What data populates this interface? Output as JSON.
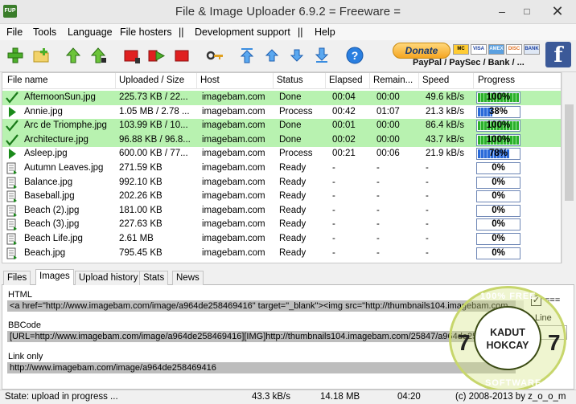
{
  "window": {
    "title": "File & Image Uploader 6.9.2  = Freeware =",
    "app_icon_text": "FUP",
    "minimize": "–",
    "maximize": "□",
    "close": "✕"
  },
  "menu": [
    "File",
    "Tools",
    "Language",
    "File hosters",
    "||",
    "Development support",
    "||",
    "Help"
  ],
  "toolbar": {
    "icons": [
      "add-icon",
      "add-folder-icon",
      "move-up-icon",
      "move-up-all-icon",
      "stop-icon",
      "forward-icon",
      "stop-all-icon",
      "key-icon",
      "top-icon",
      "up-icon",
      "down-icon",
      "bottom-icon",
      "help-icon"
    ]
  },
  "donate": {
    "label": "Donate",
    "payment_text": "PayPal / PaySec / Bank / ...",
    "cards": [
      "MC",
      "VISA",
      "AMEX",
      "DISC",
      "BANK"
    ]
  },
  "grid": {
    "columns": [
      "File name",
      "Uploaded / Size",
      "Host",
      "Status",
      "Elapsed",
      "Remain...",
      "Speed",
      "Progress"
    ],
    "rows": [
      {
        "name": "AfternoonSun.jpg",
        "size": "225.73 KB / 22...",
        "host": "imagebam.com",
        "status": "Done",
        "elapsed": "00:04",
        "remain": "00:00",
        "speed": "49.6 kB/s",
        "progress": "100%",
        "pct": 100,
        "state": "done"
      },
      {
        "name": "Annie.jpg",
        "size": "1.05 MB / 2.78 ...",
        "host": "imagebam.com",
        "status": "Process",
        "elapsed": "00:42",
        "remain": "01:07",
        "speed": "21.3 kB/s",
        "progress": "38%",
        "pct": 38,
        "state": "process"
      },
      {
        "name": "Arc de Triomphe.jpg",
        "size": "103.99 KB / 10...",
        "host": "imagebam.com",
        "status": "Done",
        "elapsed": "00:01",
        "remain": "00:00",
        "speed": "86.4 kB/s",
        "progress": "100%",
        "pct": 100,
        "state": "done"
      },
      {
        "name": "Architecture.jpg",
        "size": "96.88 KB / 96.8...",
        "host": "imagebam.com",
        "status": "Done",
        "elapsed": "00:02",
        "remain": "00:00",
        "speed": "43.7 kB/s",
        "progress": "100%",
        "pct": 100,
        "state": "done"
      },
      {
        "name": "Asleep.jpg",
        "size": "600.00 KB / 77...",
        "host": "imagebam.com",
        "status": "Process",
        "elapsed": "00:21",
        "remain": "00:06",
        "speed": "21.9 kB/s",
        "progress": "78%",
        "pct": 78,
        "state": "process"
      },
      {
        "name": "Autumn Leaves.jpg",
        "size": "271.59 KB",
        "host": "imagebam.com",
        "status": "Ready",
        "elapsed": "-",
        "remain": "-",
        "speed": "-",
        "progress": "0%",
        "pct": 0,
        "state": "ready"
      },
      {
        "name": "Balance.jpg",
        "size": "992.10 KB",
        "host": "imagebam.com",
        "status": "Ready",
        "elapsed": "-",
        "remain": "-",
        "speed": "-",
        "progress": "0%",
        "pct": 0,
        "state": "ready"
      },
      {
        "name": "Baseball.jpg",
        "size": "202.26 KB",
        "host": "imagebam.com",
        "status": "Ready",
        "elapsed": "-",
        "remain": "-",
        "speed": "-",
        "progress": "0%",
        "pct": 0,
        "state": "ready"
      },
      {
        "name": "Beach (2).jpg",
        "size": "181.00 KB",
        "host": "imagebam.com",
        "status": "Ready",
        "elapsed": "-",
        "remain": "-",
        "speed": "-",
        "progress": "0%",
        "pct": 0,
        "state": "ready"
      },
      {
        "name": "Beach (3).jpg",
        "size": "227.63 KB",
        "host": "imagebam.com",
        "status": "Ready",
        "elapsed": "-",
        "remain": "-",
        "speed": "-",
        "progress": "0%",
        "pct": 0,
        "state": "ready"
      },
      {
        "name": "Beach Life.jpg",
        "size": "2.61 MB",
        "host": "imagebam.com",
        "status": "Ready",
        "elapsed": "-",
        "remain": "-",
        "speed": "-",
        "progress": "0%",
        "pct": 0,
        "state": "ready"
      },
      {
        "name": "Beach.jpg",
        "size": "795.45 KB",
        "host": "imagebam.com",
        "status": "Ready",
        "elapsed": "-",
        "remain": "-",
        "speed": "-",
        "progress": "0%",
        "pct": 0,
        "state": "ready"
      }
    ]
  },
  "tabs": [
    "Files",
    "Images",
    "Upload history",
    "Stats",
    "News"
  ],
  "active_tab": "Images",
  "panel": {
    "html_label": "HTML",
    "html_value": "<a href=\"http://www.imagebam.com/image/a964de258469416\" target=\"_blank\"><img src=\"http://thumbnails104.imagebam.com",
    "bbcode_label": "BBCode",
    "bbcode_value": "[URL=http://www.imagebam.com/image/a964de258469416][IMG]http://thumbnails104.imagebam.com/25847/a964de2584694",
    "link_label": "Link only",
    "link_value": "http://www.imagebam.com/image/a964de258469416",
    "checkbox_mark": "✓",
    "checkbox_label": "===",
    "line_label": "Line"
  },
  "statusbar": {
    "state": "State: upload in progress ...",
    "speed": "43.3 kB/s",
    "total": "14.18 MB",
    "time": "04:20",
    "copyright": "(c) 2008-2013 by z_o_o_m"
  },
  "stamp": {
    "line1": "KADUT",
    "line2": "HOKCAY",
    "number": "7",
    "ring_top": "100% FREE",
    "ring_bottom": "SOFTWARE"
  }
}
